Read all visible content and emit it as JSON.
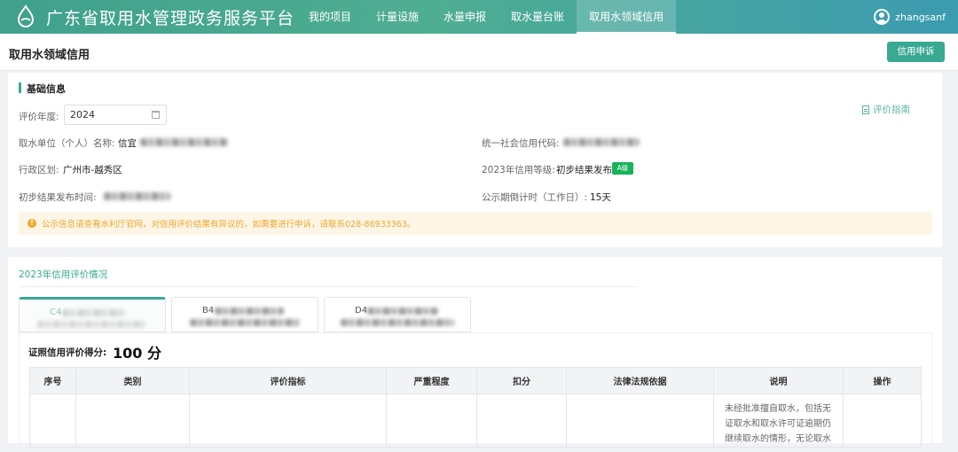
{
  "header": {
    "app_title": "广东省取用水管理政务服务平台",
    "nav": [
      "我的项目",
      "计量设施",
      "水量申报",
      "取水量台账",
      "取用水领域信用"
    ],
    "active_nav": "取用水领域信用",
    "username": "zhangsanf"
  },
  "page": {
    "title": "取用水领域信用",
    "appeal_button": "信用申诉"
  },
  "basic_info": {
    "section_title": "基础信息",
    "guide_link": "评价指南",
    "year_label": "评价年度:",
    "year_value": "2024",
    "unit_label": "取水单位（个人）名称:",
    "unit_value_visible": "信宜",
    "region_label": "行政区划:",
    "region_value": "广州市-越秀区",
    "publish_time_label": "初步结果发布时间:",
    "credit_code_label": "统一社会信用代码:",
    "credit_level_label": "2023年信用等级:",
    "credit_level_value": "初步结果发布",
    "credit_level_badge": "A级",
    "countdown_label": "公示期倒计时（工作日）:",
    "countdown_value": "15天",
    "notice": "公示信息请查看水利厅官网，对信用评价结果有异议的，如需要进行申诉，请联系028-86933363。"
  },
  "evaluation": {
    "section_title": "2023年信用评价情况",
    "tabs": [
      {
        "code_prefix": "C4",
        "active": true
      },
      {
        "code_prefix": "B4",
        "active": false
      },
      {
        "code_prefix": "D4",
        "active": false
      }
    ],
    "score_label": "证照信用评价得分:",
    "score_value": "100 分",
    "table": {
      "columns": [
        "序号",
        "类别",
        "评价指标",
        "严重程度",
        "扣分",
        "法律法规依据",
        "说明",
        "操作"
      ],
      "rows": [
        {
          "description": "未经批准擅自取水，包括无证取水和取水许可证逾期仍继续取水的情形，无论取水"
        }
      ]
    }
  },
  "colors": {
    "accent": "#3aa992",
    "warning": "#f0a72c",
    "badge_green": "#18b35a"
  }
}
